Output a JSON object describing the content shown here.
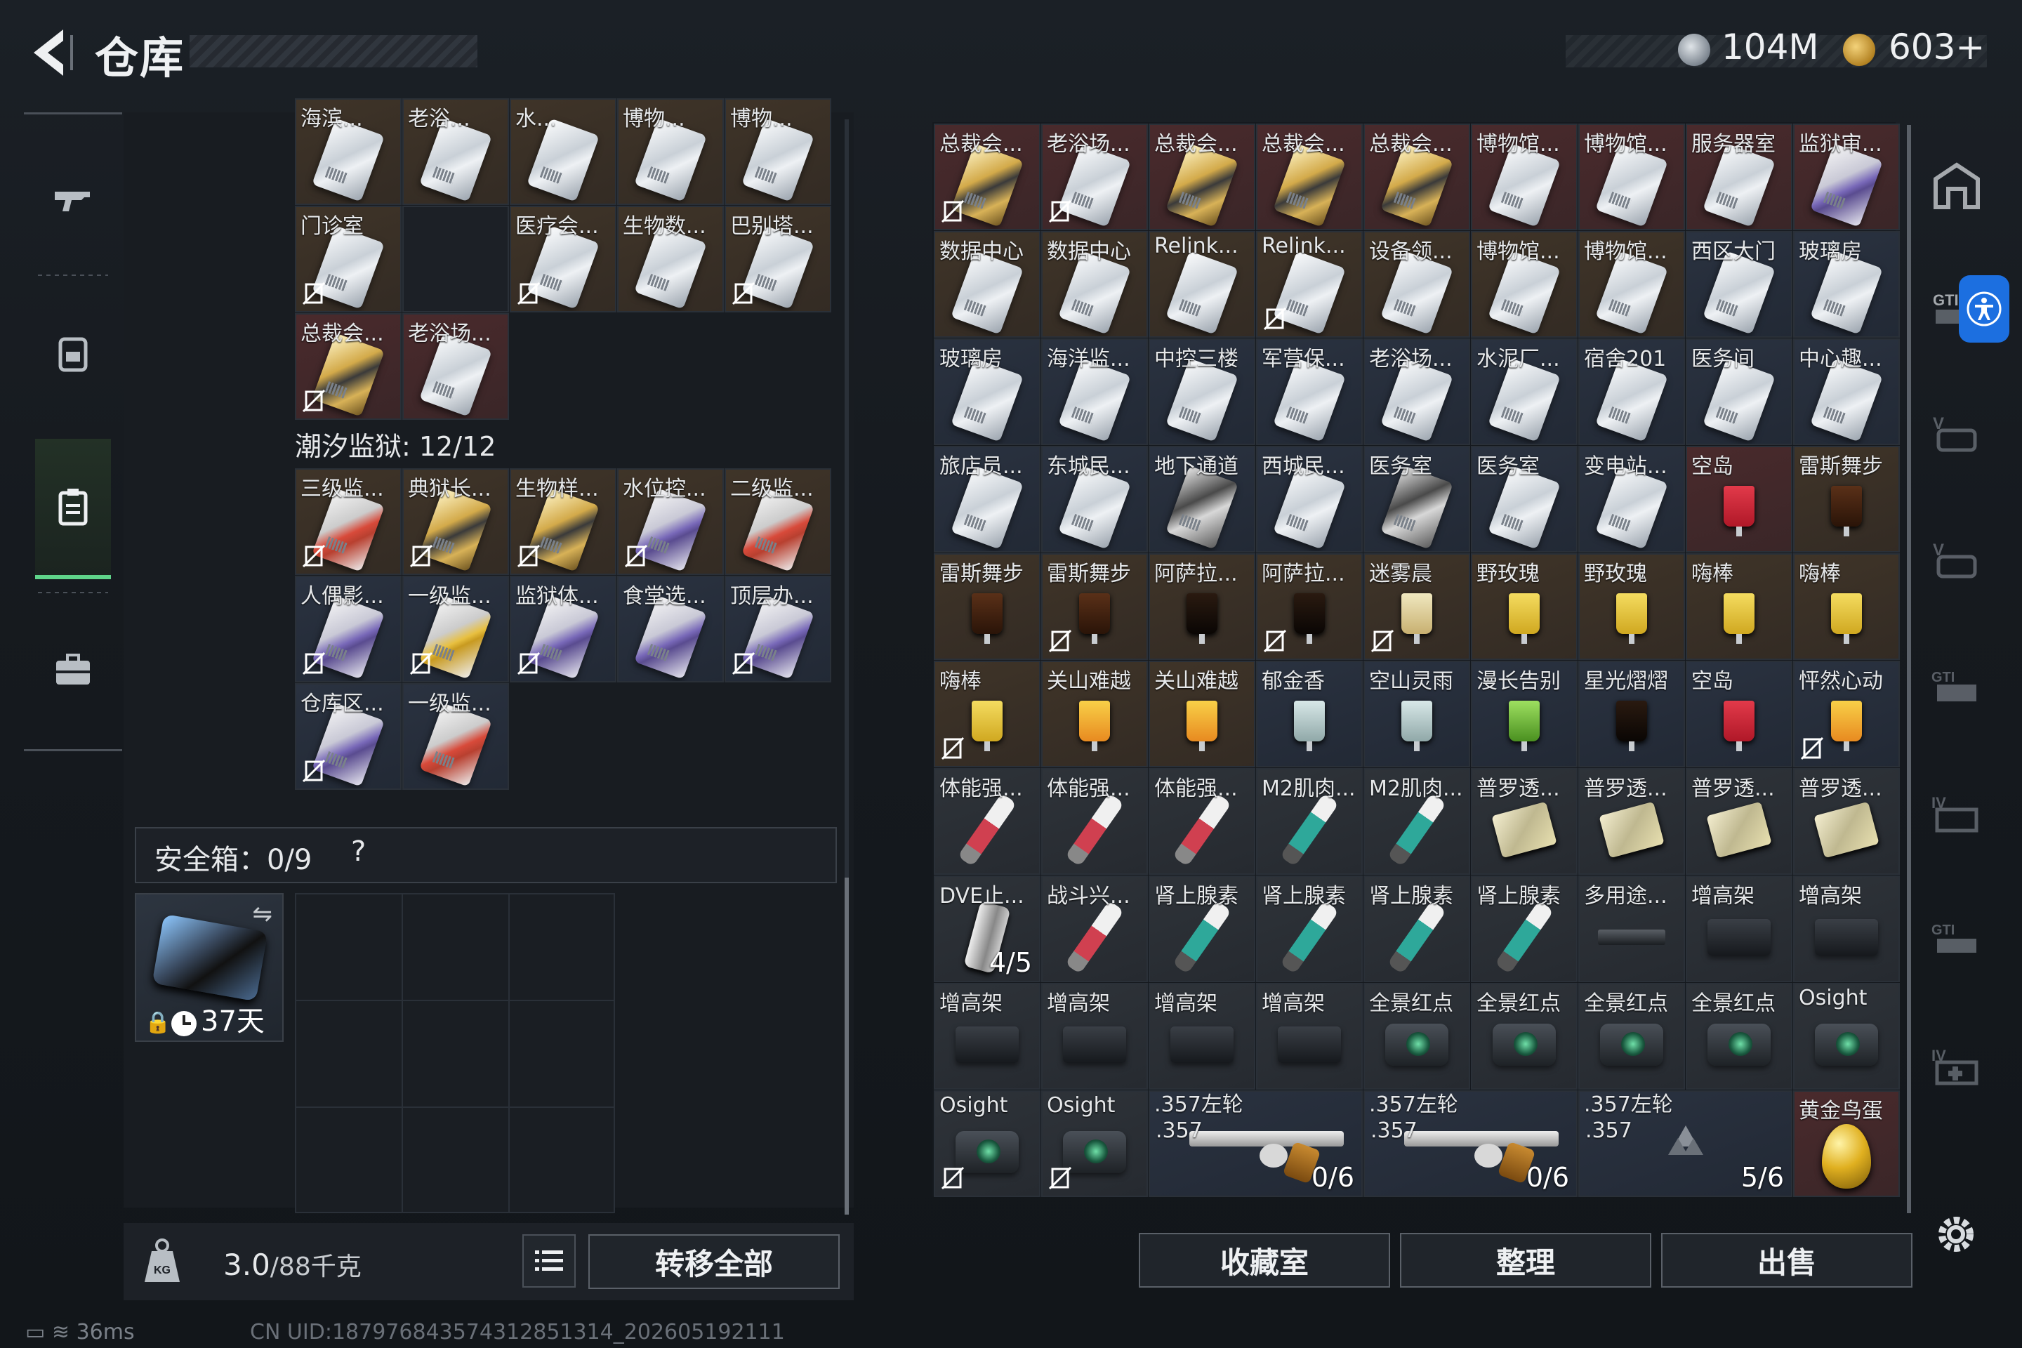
{
  "header": {
    "title": "仓库",
    "currency1": "104M",
    "currency2": "603+"
  },
  "left": {
    "section_title": "潮汐监狱: 12/12",
    "top_rows": [
      [
        {
          "label": "海滨...",
          "kind": "card",
          "color": "c-brown"
        },
        {
          "label": "老浴...",
          "kind": "card",
          "color": "c-brown"
        },
        {
          "label": "水...",
          "kind": "card",
          "color": "c-brown"
        },
        {
          "label": "博物...",
          "kind": "card",
          "color": "c-brown"
        },
        {
          "label": "博物...",
          "kind": "card",
          "color": "c-brown"
        }
      ],
      [
        {
          "label": "门诊室",
          "kind": "card",
          "color": "c-brown",
          "nodrop": true
        },
        {
          "label": "",
          "kind": "empty",
          "color": "c-empty"
        },
        {
          "label": "医疗会...",
          "kind": "card",
          "color": "c-brown",
          "nodrop": true
        },
        {
          "label": "生物数...",
          "kind": "card",
          "color": "c-brown"
        },
        {
          "label": "巴别塔...",
          "kind": "card",
          "color": "c-brown",
          "nodrop": true
        }
      ],
      [
        {
          "label": "总裁会...",
          "kind": "card-gold",
          "color": "c-red",
          "nodrop": true
        },
        {
          "label": "老浴场...",
          "kind": "card",
          "color": "c-red"
        }
      ]
    ],
    "prison_rows": [
      [
        {
          "label": "三级监...",
          "kind": "card-red",
          "color": "c-brown",
          "nodrop": true
        },
        {
          "label": "典狱长...",
          "kind": "card-gold",
          "color": "c-brown",
          "nodrop": true
        },
        {
          "label": "生物样...",
          "kind": "card-gold",
          "color": "c-brown",
          "nodrop": true
        },
        {
          "label": "水位控...",
          "kind": "card-purple",
          "color": "c-brown",
          "nodrop": true
        },
        {
          "label": "二级监...",
          "kind": "card-red",
          "color": "c-brown"
        }
      ],
      [
        {
          "label": "人偶影...",
          "kind": "card-purple",
          "color": "c-darkblue",
          "nodrop": true
        },
        {
          "label": "一级监...",
          "kind": "card-yellow",
          "color": "c-darkblue",
          "nodrop": true
        },
        {
          "label": "监狱体...",
          "kind": "card-purple",
          "color": "c-darkblue",
          "nodrop": true
        },
        {
          "label": "食堂选...",
          "kind": "card-purple",
          "color": "c-darkblue"
        },
        {
          "label": "顶层办...",
          "kind": "card-purple",
          "color": "c-darkblue",
          "nodrop": true
        }
      ],
      [
        {
          "label": "仓库区...",
          "kind": "card-purple",
          "color": "c-darkblue",
          "nodrop": true
        },
        {
          "label": "一级监...",
          "kind": "card-red",
          "color": "c-darkblue"
        }
      ]
    ],
    "safebox_label": "安全箱：0/9",
    "safebox_help": "?",
    "safe_case_days": "37天",
    "weight": "3.0",
    "weight_max": "/88千克",
    "transfer_all": "转移全部"
  },
  "right": {
    "items": [
      [
        {
          "label": "总裁会...",
          "kind": "card-gold",
          "color": "c-red",
          "nodrop": true
        },
        {
          "label": "老浴场...",
          "kind": "card",
          "color": "c-red",
          "nodrop": true
        },
        {
          "label": "总裁会...",
          "kind": "card-gold",
          "color": "c-red"
        },
        {
          "label": "总裁会...",
          "kind": "card-gold",
          "color": "c-red"
        },
        {
          "label": "总裁会...",
          "kind": "card-gold",
          "color": "c-red"
        },
        {
          "label": "博物馆...",
          "kind": "card",
          "color": "c-red"
        },
        {
          "label": "博物馆...",
          "kind": "card",
          "color": "c-red"
        },
        {
          "label": "服务器室",
          "kind": "card",
          "color": "c-red"
        },
        {
          "label": "监狱审...",
          "kind": "card-purple",
          "color": "c-red"
        }
      ],
      [
        {
          "label": "数据中心",
          "kind": "card",
          "color": "c-brown"
        },
        {
          "label": "数据中心",
          "kind": "card",
          "color": "c-brown"
        },
        {
          "label": "Relink...",
          "kind": "card",
          "color": "c-brown"
        },
        {
          "label": "Relink...",
          "kind": "card",
          "color": "c-brown",
          "nodrop": true
        },
        {
          "label": "设备领...",
          "kind": "card",
          "color": "c-brown"
        },
        {
          "label": "博物馆...",
          "kind": "card",
          "color": "c-brown"
        },
        {
          "label": "博物馆...",
          "kind": "card",
          "color": "c-brown"
        },
        {
          "label": "西区大门",
          "kind": "card",
          "color": "c-darkblue"
        },
        {
          "label": "玻璃房",
          "kind": "card",
          "color": "c-darkblue"
        }
      ],
      [
        {
          "label": "玻璃房",
          "kind": "card",
          "color": "c-darkblue"
        },
        {
          "label": "海洋监...",
          "kind": "card",
          "color": "c-darkblue"
        },
        {
          "label": "中控三楼",
          "kind": "card",
          "color": "c-darkblue"
        },
        {
          "label": "军营保...",
          "kind": "card",
          "color": "c-darkblue"
        },
        {
          "label": "老浴场...",
          "kind": "card",
          "color": "c-darkblue"
        },
        {
          "label": "水泥厂...",
          "kind": "card",
          "color": "c-darkblue"
        },
        {
          "label": "宿舍201",
          "kind": "card",
          "color": "c-darkblue"
        },
        {
          "label": "医务间",
          "kind": "card",
          "color": "c-darkblue"
        },
        {
          "label": "中心趣...",
          "kind": "card",
          "color": "c-darkblue"
        }
      ],
      [
        {
          "label": "旅店员...",
          "kind": "card",
          "color": "c-darkblue"
        },
        {
          "label": "东城民...",
          "kind": "card",
          "color": "c-darkblue"
        },
        {
          "label": "地下通道",
          "kind": "card-dark",
          "color": "c-darkblue"
        },
        {
          "label": "西城民...",
          "kind": "card",
          "color": "c-darkblue"
        },
        {
          "label": "医务室",
          "kind": "card-dark",
          "color": "c-darkblue"
        },
        {
          "label": "医务室",
          "kind": "card",
          "color": "c-darkblue"
        },
        {
          "label": "变电站...",
          "kind": "card",
          "color": "c-darkblue"
        },
        {
          "label": "空岛",
          "kind": "drink-red",
          "color": "c-red"
        },
        {
          "label": "雷斯舞步",
          "kind": "drink-brown",
          "color": "c-brown"
        }
      ],
      [
        {
          "label": "雷斯舞步",
          "kind": "drink-brown",
          "color": "c-brown"
        },
        {
          "label": "雷斯舞步",
          "kind": "drink-brown",
          "color": "c-brown",
          "nodrop": true
        },
        {
          "label": "阿萨拉...",
          "kind": "drink-dark",
          "color": "c-brown"
        },
        {
          "label": "阿萨拉...",
          "kind": "drink-dark",
          "color": "c-brown",
          "nodrop": true
        },
        {
          "label": "迷雾晨",
          "kind": "drink-martini",
          "color": "c-brown",
          "nodrop": true
        },
        {
          "label": "野玫瑰",
          "kind": "drink-yellow",
          "color": "c-brown"
        },
        {
          "label": "野玫瑰",
          "kind": "drink-yellow",
          "color": "c-brown"
        },
        {
          "label": "嗨棒",
          "kind": "drink-yellow",
          "color": "c-brown"
        },
        {
          "label": "嗨棒",
          "kind": "drink-yellow",
          "color": "c-brown"
        }
      ],
      [
        {
          "label": "嗨棒",
          "kind": "drink-yellow",
          "color": "c-brown",
          "nodrop": true
        },
        {
          "label": "关山难越",
          "kind": "drink-orange",
          "color": "c-brown"
        },
        {
          "label": "关山难越",
          "kind": "drink-orange",
          "color": "c-brown"
        },
        {
          "label": "郁金香",
          "kind": "drink-clear",
          "color": "c-darkblue"
        },
        {
          "label": "空山灵雨",
          "kind": "drink-clear",
          "color": "c-darkblue"
        },
        {
          "label": "漫长告别",
          "kind": "drink-green",
          "color": "c-darkblue"
        },
        {
          "label": "星光熠熠",
          "kind": "drink-dark",
          "color": "c-darkblue"
        },
        {
          "label": "空岛",
          "kind": "drink-red",
          "color": "c-darkblue"
        },
        {
          "label": "怦然心动",
          "kind": "drink-orange",
          "color": "c-darkblue",
          "nodrop": true
        }
      ],
      [
        {
          "label": "体能强...",
          "kind": "syr-red",
          "color": "c-gray"
        },
        {
          "label": "体能强...",
          "kind": "syr-red",
          "color": "c-gray"
        },
        {
          "label": "体能强...",
          "kind": "syr-red",
          "color": "c-gray"
        },
        {
          "label": "M2肌肉...",
          "kind": "syr-teal",
          "color": "c-gray"
        },
        {
          "label": "M2肌肉...",
          "kind": "syr-teal",
          "color": "c-gray"
        },
        {
          "label": "普罗透...",
          "kind": "pack",
          "color": "c-gray"
        },
        {
          "label": "普罗透...",
          "kind": "pack",
          "color": "c-gray"
        },
        {
          "label": "普罗透...",
          "kind": "pack",
          "color": "c-gray"
        },
        {
          "label": "普罗透...",
          "kind": "pack",
          "color": "c-gray"
        }
      ],
      [
        {
          "label": "DVE止...",
          "kind": "bottle",
          "color": "c-gray",
          "count": "4/5"
        },
        {
          "label": "战斗兴...",
          "kind": "syr-red",
          "color": "c-gray"
        },
        {
          "label": "肾上腺素",
          "kind": "syr-teal",
          "color": "c-gray"
        },
        {
          "label": "肾上腺素",
          "kind": "syr-teal",
          "color": "c-gray"
        },
        {
          "label": "肾上腺素",
          "kind": "syr-teal",
          "color": "c-gray"
        },
        {
          "label": "肾上腺素",
          "kind": "syr-teal",
          "color": "c-gray"
        },
        {
          "label": "多用途...",
          "kind": "rail",
          "color": "c-gray"
        },
        {
          "label": "增高架",
          "kind": "riser",
          "color": "c-gray"
        },
        {
          "label": "增高架",
          "kind": "riser",
          "color": "c-gray"
        }
      ],
      [
        {
          "label": "增高架",
          "kind": "riser",
          "color": "c-gray"
        },
        {
          "label": "增高架",
          "kind": "riser",
          "color": "c-gray"
        },
        {
          "label": "增高架",
          "kind": "riser",
          "color": "c-gray"
        },
        {
          "label": "增高架",
          "kind": "riser",
          "color": "c-gray"
        },
        {
          "label": "全景红点",
          "kind": "scope",
          "color": "c-gray"
        },
        {
          "label": "全景红点",
          "kind": "scope",
          "color": "c-gray"
        },
        {
          "label": "全景红点",
          "kind": "scope",
          "color": "c-gray"
        },
        {
          "label": "全景红点",
          "kind": "scope",
          "color": "c-gray"
        },
        {
          "label": "Osight",
          "kind": "scope",
          "color": "c-gray"
        }
      ],
      [
        {
          "label": "Osight",
          "kind": "scope",
          "color": "c-gray",
          "nodrop": true
        },
        {
          "label": "Osight",
          "kind": "scope",
          "color": "c-gray",
          "nodrop": true
        }
      ]
    ],
    "ammo": [
      {
        "label": ".357左轮",
        "sub": ".357",
        "count": "0/6"
      },
      {
        "label": ".357左轮",
        "sub": ".357",
        "count": "0/6"
      },
      {
        "label": ".357左轮",
        "sub": ".357",
        "count": "5/6"
      }
    ],
    "egg_label": "黄金鸟蛋",
    "buttons": {
      "vault": "收藏室",
      "sort": "整理",
      "sell": "出售"
    }
  },
  "status": {
    "ping": "36ms",
    "uid": "CN UID:187976843574312851314_202605192111"
  },
  "colors": {
    "accent_green": "#5fd48a",
    "accessibility_blue": "#1c6fe0"
  }
}
